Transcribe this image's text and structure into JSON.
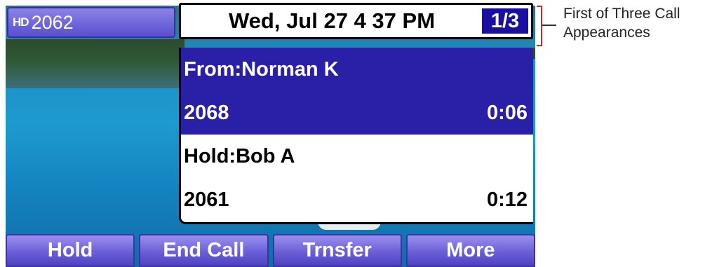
{
  "line": {
    "hd_badge": "HD",
    "extension": "2062"
  },
  "status": {
    "datetime": "Wed, Jul 27  4 37 PM",
    "page_indicator": "1/3"
  },
  "calls": [
    {
      "label": "From:Norman K",
      "number": "2068",
      "duration": "0:06",
      "state": "active"
    },
    {
      "label": "Hold:Bob A",
      "number": "2061",
      "duration": "0:12",
      "state": "hold"
    }
  ],
  "softkeys": [
    "Hold",
    "End Call",
    "Trnsfer",
    "More"
  ],
  "annotation": {
    "text": "First of Three Call\nAppearances"
  },
  "colors": {
    "accent": "#2a20a8",
    "softkey": "#6b5fd8",
    "callout_bracket": "#c62828"
  }
}
